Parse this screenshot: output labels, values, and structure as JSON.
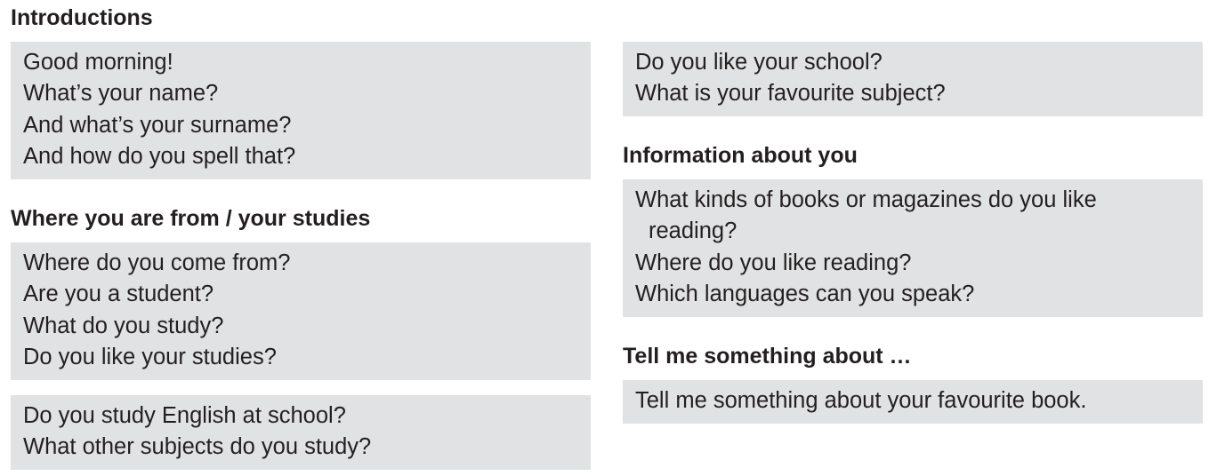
{
  "left": {
    "introductions": {
      "heading": "Introductions",
      "questions": [
        "Good morning!",
        "What’s your name?",
        "And what’s your surname?",
        "And how do you spell that?"
      ]
    },
    "where_from": {
      "heading": "Where you are from / your studies",
      "questions": [
        "Where do you come from?",
        "Are you a student?",
        "What do you study?",
        "Do you like your studies?"
      ]
    },
    "english": {
      "questions": [
        "Do you study English at school?",
        "What other subjects do you study?"
      ]
    }
  },
  "right": {
    "school": {
      "questions": [
        "Do you like your school?",
        "What is your favourite subject?"
      ]
    },
    "information": {
      "heading": "Information about you",
      "questions": [
        "What kinds of books or magazines do you like",
        "reading?",
        "Where do you like reading?",
        "Which languages can you speak?"
      ]
    },
    "tell_me": {
      "heading": "Tell me something about …",
      "questions": [
        "Tell me something about your favourite book."
      ]
    }
  }
}
